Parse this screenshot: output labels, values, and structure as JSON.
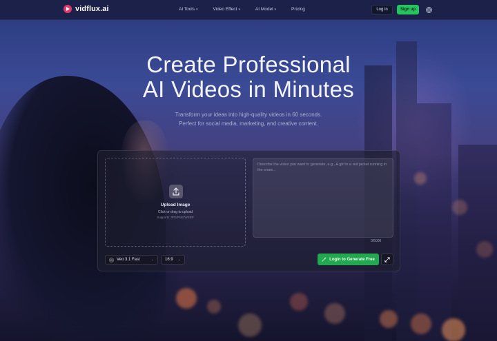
{
  "brand": {
    "name": "vidflux.ai",
    "accent": "#22c55e",
    "logo_color": "#e03a6a"
  },
  "nav": {
    "items": [
      {
        "label": "AI Tools",
        "has_dropdown": true
      },
      {
        "label": "Video Effect",
        "has_dropdown": true
      },
      {
        "label": "AI Model",
        "has_dropdown": true
      },
      {
        "label": "Pricing",
        "has_dropdown": false
      }
    ],
    "login_label": "Log in",
    "signup_label": "Sign up",
    "language_icon": "globe-icon"
  },
  "hero": {
    "title_line1": "Create Professional",
    "title_line2": "AI Videos in Minutes",
    "subtitle_line1": "Transform your ideas into high-quality videos in 60 seconds.",
    "subtitle_line2": "Perfect for social media, marketing, and creative content."
  },
  "generator": {
    "upload": {
      "icon": "upload-icon",
      "title": "Upload Image",
      "hint": "Click or drag to upload",
      "formats": "Supports JPG/PNG/WEBP"
    },
    "prompt": {
      "placeholder": "Describe the video you want to generate, e.g., A girl in a red jacket running in the snow...",
      "value": "",
      "counter": "0/5000"
    },
    "model_select": {
      "value": "Veo 3.1 Fast",
      "badge": "G"
    },
    "ratio_select": {
      "value": "16:9"
    },
    "generate_label": "Login to Generate Free",
    "expand_icon": "expand-icon"
  }
}
